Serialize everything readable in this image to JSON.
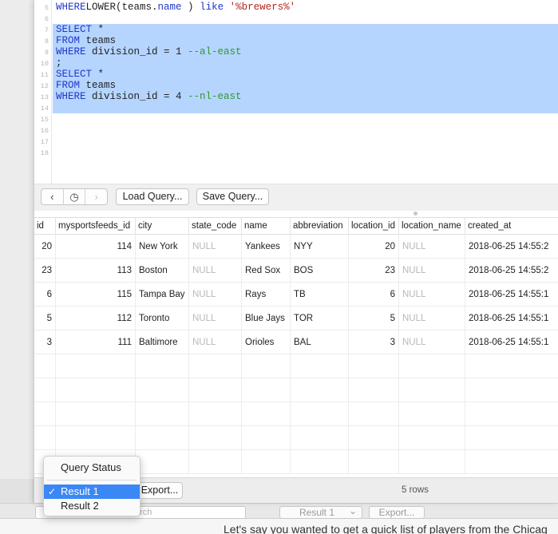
{
  "editor": {
    "lines": [
      {
        "num": "5",
        "selected": false,
        "tokens": [
          [
            "kw",
            "WHERE"
          ],
          [
            "",
            "LOWER(teams."
          ],
          [
            "kw",
            "name"
          ],
          [
            "",
            " ) "
          ],
          [
            "kw",
            "like"
          ],
          [
            "",
            ""
          ],
          [
            "str",
            " '%brewers%'"
          ]
        ]
      },
      {
        "num": "6",
        "selected": false,
        "tokens": []
      },
      {
        "num": "7",
        "selected": true,
        "tokens": [
          [
            "kw",
            "SELECT"
          ],
          [
            "",
            " *"
          ]
        ]
      },
      {
        "num": "8",
        "selected": true,
        "tokens": [
          [
            "kw",
            "FROM"
          ],
          [
            "",
            " teams"
          ]
        ]
      },
      {
        "num": "9",
        "selected": true,
        "tokens": [
          [
            "kw",
            "WHERE"
          ],
          [
            "",
            " division_id = 1 "
          ],
          [
            "cmt",
            "--al-east"
          ]
        ]
      },
      {
        "num": "10",
        "selected": true,
        "tokens": [
          [
            "",
            ";"
          ]
        ]
      },
      {
        "num": "11",
        "selected": true,
        "tokens": [
          [
            "kw",
            "SELECT"
          ],
          [
            "",
            " *"
          ]
        ]
      },
      {
        "num": "12",
        "selected": true,
        "tokens": [
          [
            "kw",
            "FROM"
          ],
          [
            "",
            " teams"
          ]
        ]
      },
      {
        "num": "13",
        "selected": true,
        "tokens": [
          [
            "kw",
            "WHERE"
          ],
          [
            "",
            " division_id = 4 "
          ],
          [
            "cmt",
            "--nl-east"
          ]
        ]
      },
      {
        "num": "14",
        "selected": true,
        "tokens": []
      },
      {
        "num": "15",
        "selected": false,
        "tokens": []
      },
      {
        "num": "16",
        "selected": false,
        "tokens": []
      },
      {
        "num": "17",
        "selected": false,
        "tokens": []
      },
      {
        "num": "18",
        "selected": false,
        "tokens": []
      }
    ]
  },
  "toolbar": {
    "back_icon": "‹",
    "history_icon": "◷",
    "forward_icon": "›",
    "load_query": "Load Query...",
    "save_query": "Save Query..."
  },
  "table": {
    "columns": [
      "id",
      "mysportsfeeds_id",
      "city",
      "state_code",
      "name",
      "abbreviation",
      "location_id",
      "location_name",
      "created_at"
    ],
    "rows": [
      [
        "20",
        "114",
        "New York",
        "NULL",
        "Yankees",
        "NYY",
        "20",
        "NULL",
        "2018-06-25 14:55:2"
      ],
      [
        "23",
        "113",
        "Boston",
        "NULL",
        "Red Sox",
        "BOS",
        "23",
        "NULL",
        "2018-06-25 14:55:2"
      ],
      [
        "6",
        "115",
        "Tampa Bay",
        "NULL",
        "Rays",
        "TB",
        "6",
        "NULL",
        "2018-06-25 14:55:1"
      ],
      [
        "5",
        "112",
        "Toronto",
        "NULL",
        "Blue Jays",
        "TOR",
        "5",
        "NULL",
        "2018-06-25 14:55:1"
      ],
      [
        "3",
        "111",
        "Baltimore",
        "NULL",
        "Orioles",
        "BAL",
        "3",
        "NULL",
        "2018-06-25 14:55:1"
      ]
    ]
  },
  "statusbar": {
    "export_label": "Export...",
    "rows_count": "5 rows"
  },
  "menu": {
    "query_status": "Query Status",
    "result_1": "Result 1",
    "result_2": "Result 2",
    "check": "✓"
  },
  "background": {
    "search_placeholder": "arch",
    "result_select": "Result 1",
    "result_chevron": "⌄",
    "export_label": "Export...",
    "article_text": "Let's say you wanted to get a quick list of players from the Chicag"
  }
}
